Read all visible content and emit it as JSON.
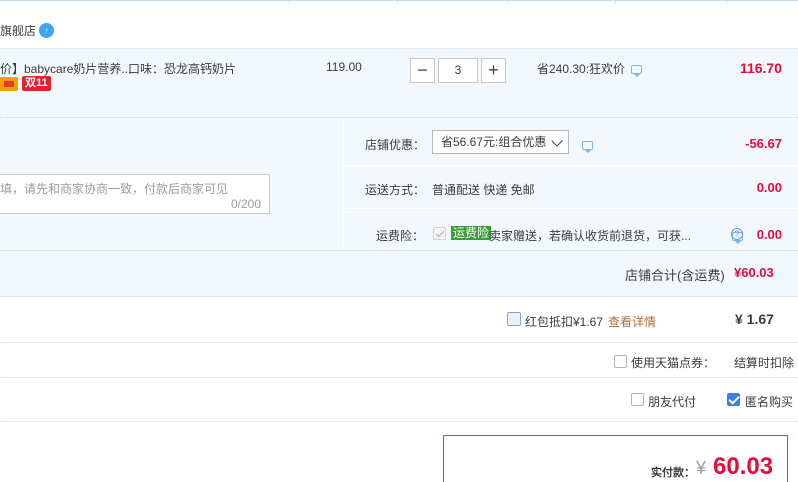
{
  "store": {
    "name": "旗舰店",
    "badge_text": "↑"
  },
  "item": {
    "title": "价】babycare奶片营养...",
    "spec": "口味：恐龙高钙奶片",
    "tag_double": "双11",
    "unit_price": "119.00",
    "qty": "3",
    "qty_minus": "−",
    "qty_plus": "+",
    "discount_note": "省240.30:狂欢价",
    "subtotal": "116.70"
  },
  "memo": {
    "placeholder": "填，请先和商家协商一致，付款后商家可见",
    "count": "0/200"
  },
  "options": {
    "promo_label": "店铺优惠：",
    "promo_select": "省56.67元:组合优惠",
    "promo_amount": "-56.67",
    "shipping_label": "运送方式：",
    "shipping_method": "普通配送 快递 免邮",
    "shipping_amount": "0.00",
    "insurance_label": "运费险：",
    "insurance_tag": "运费险",
    "insurance_text": "卖家赠送，若确认收货前退货，可获...",
    "insurance_amount": "0.00",
    "help_mark": "?"
  },
  "store_total": {
    "label": "店铺合计(含运费)",
    "value": "¥60.03"
  },
  "redpack": {
    "label": "红包抵扣¥1.67",
    "link": "查看详情",
    "amount": "¥ 1.67"
  },
  "tmall_points": {
    "label": "使用天猫点券：",
    "note": "结算时扣除"
  },
  "friend_pay": {
    "label": "朋友代付"
  },
  "anonymous": {
    "label": "匿名购买"
  },
  "payment": {
    "label": "实付款：",
    "currency": "¥",
    "value": "60.03"
  }
}
